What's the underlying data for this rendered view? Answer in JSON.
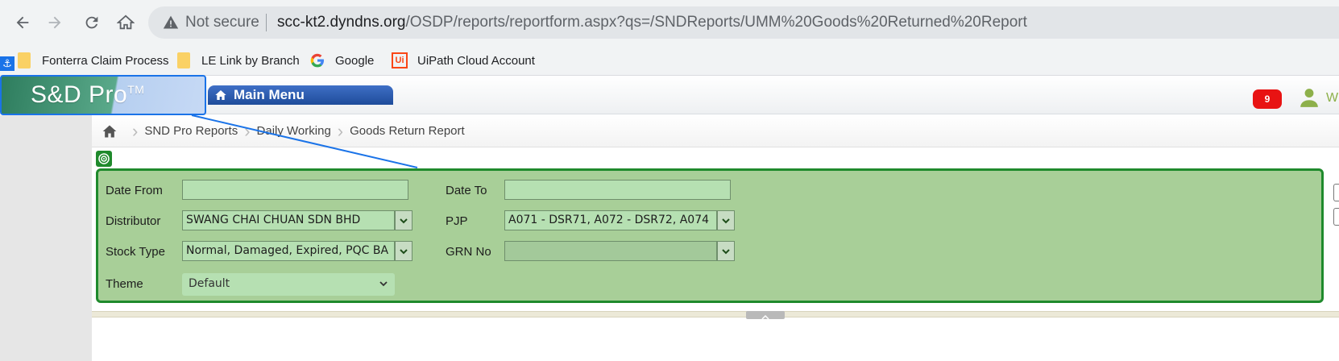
{
  "browser": {
    "not_secure_label": "Not secure",
    "url_host": "scc-kt2.dyndns.org",
    "url_path": "/OSDP/reports/reportform.aspx?qs=/SNDReports/UMM%20Goods%20Returned%20Report"
  },
  "bookmarks": [
    {
      "label": "Fonterra Claim Process",
      "icon": "folder-icon"
    },
    {
      "label": "LE Link by Branch",
      "icon": "folder-icon"
    },
    {
      "label": "Google",
      "icon": "google-icon"
    },
    {
      "label": "UiPath Cloud Account",
      "icon": "uipath-icon"
    }
  ],
  "app": {
    "logo_text": "S&D Pro",
    "logo_tm": "TM",
    "main_menu_label": "Main Menu",
    "notification_count": "9",
    "user_initial": "W"
  },
  "breadcrumb": [
    "SND Pro Reports",
    "Daily Working",
    "Goods Return Report"
  ],
  "form": {
    "date_from_label": "Date From",
    "date_from_value": "",
    "date_to_label": "Date To",
    "date_to_value": "",
    "distributor_label": "Distributor",
    "distributor_value": "SWANG CHAI CHUAN SDN BHD",
    "pjp_label": "PJP",
    "pjp_value": "A071 - DSR71, A072 - DSR72, A074",
    "stock_type_label": "Stock Type",
    "stock_type_value": "Normal, Damaged, Expired, PQC BA",
    "grn_label": "GRN No",
    "grn_value": "",
    "theme_label": "Theme",
    "theme_value": "Default"
  },
  "colors": {
    "panel_bg": "#a8cf98",
    "panel_border": "#1f8a2c",
    "field_bg": "#b6e0b2",
    "badge": "#e81313",
    "accent": "#1a73e8"
  }
}
